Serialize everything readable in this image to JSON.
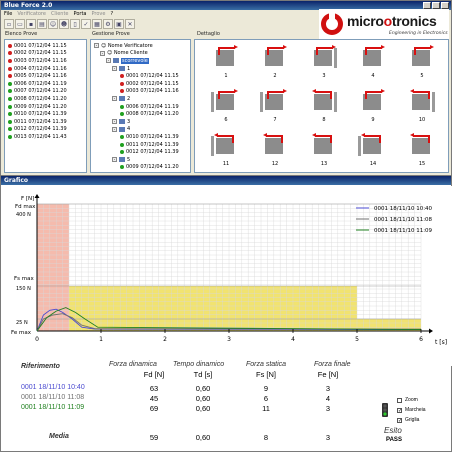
{
  "app": {
    "title": "Blue Force 2.0",
    "menu": [
      "File",
      "Verificatore",
      "Cliente",
      "Porta",
      "Prove",
      "?"
    ],
    "logo_text_black": "micro",
    "logo_text_red": "o",
    "logo_text_rest": "tronics",
    "logo_tagline": "Engineering in Electronics"
  },
  "elenco": {
    "header": "Elenco Prove",
    "items": [
      {
        "label": "0001 07/12/04 11.15",
        "status": "red"
      },
      {
        "label": "0002 07/12/04 11.15",
        "status": "red"
      },
      {
        "label": "0003 07/12/04 11.16",
        "status": "red"
      },
      {
        "label": "0004 07/12/04 11.16",
        "status": "red"
      },
      {
        "label": "0005 07/12/04 11.16",
        "status": "red"
      },
      {
        "label": "0006 07/12/04 11.19",
        "status": "green"
      },
      {
        "label": "0007 07/12/04 11.20",
        "status": "green"
      },
      {
        "label": "0008 07/12/04 11.20",
        "status": "green"
      },
      {
        "label": "0009 07/12/04 11.20",
        "status": "green"
      },
      {
        "label": "0010 07/12/04 11.39",
        "status": "green"
      },
      {
        "label": "0011 07/12/04 11.39",
        "status": "green"
      },
      {
        "label": "0012 07/12/04 11.39",
        "status": "green"
      },
      {
        "label": "0013 07/12/04 11.43",
        "status": "green"
      }
    ]
  },
  "gestione": {
    "header": "Gestione Prove",
    "root": "Nome Verificatore",
    "client": "Nome Cliente",
    "selected": "scorrevole",
    "groups": [
      {
        "num": "1",
        "items": [
          {
            "label": "0001 07/12/04 11.15",
            "status": "red"
          },
          {
            "label": "0002 07/12/04 11.15",
            "status": "red"
          },
          {
            "label": "0003 07/12/04 11.16",
            "status": "red"
          }
        ]
      },
      {
        "num": "2",
        "items": [
          {
            "label": "0006 07/12/04 11.19",
            "status": "green"
          },
          {
            "label": "0008 07/12/04 11.20",
            "status": "green"
          }
        ]
      },
      {
        "num": "3",
        "items": []
      },
      {
        "num": "4",
        "items": [
          {
            "label": "0010 07/12/04 11.39",
            "status": "green"
          },
          {
            "label": "0011 07/12/04 11.39",
            "status": "green"
          },
          {
            "label": "0012 07/12/04 11.39",
            "status": "green"
          }
        ]
      },
      {
        "num": "5",
        "items": [
          {
            "label": "0009 07/12/04 11.20",
            "status": "green"
          }
        ]
      }
    ]
  },
  "dettaglio": {
    "header": "Dettaglio",
    "cells": [
      "1",
      "2",
      "3",
      "4",
      "5",
      "6",
      "7",
      "8",
      "9",
      "10",
      "11",
      "12",
      "13",
      "14",
      "15"
    ]
  },
  "grafico": {
    "title": "Grafico",
    "y_unit": "F [N]",
    "x_unit": "t [s]",
    "fd_max_label": "Fd max",
    "fd_max_value": "400 N",
    "fs_max_label": "Fs max",
    "fs_max_value": "150 N",
    "fe_max_label": "Fe max",
    "fe_max_value": "25 N",
    "legend": [
      {
        "label": "0001 18/11/10 10:40",
        "color": "#4a4ad0"
      },
      {
        "label": "0001 18/11/10 11:08",
        "color": "#707070"
      },
      {
        "label": "0001 18/11/10 11:09",
        "color": "#208020"
      }
    ]
  },
  "chart_data": {
    "type": "line",
    "xlabel": "t (s)",
    "ylabel": "F [N]",
    "xlim": [
      0,
      6
    ],
    "x_ticks": [
      "0",
      "1",
      "2",
      "3",
      "4",
      "5",
      "6"
    ],
    "limits": {
      "Fd max": 400,
      "Fs max": 150,
      "Fe max": 25
    },
    "regions": [
      {
        "name": "dynamic",
        "x": [
          0,
          0.5
        ],
        "y": [
          0,
          400
        ],
        "color": "#f4b4a4"
      },
      {
        "name": "static",
        "x": [
          0.5,
          5
        ],
        "y": [
          0,
          150
        ],
        "color": "#f0e060"
      },
      {
        "name": "final",
        "x": [
          5,
          6
        ],
        "y": [
          0,
          25
        ],
        "color": "#f0e060"
      }
    ],
    "series": [
      {
        "name": "0001 18/11/10 10:40",
        "color": "#4a4ad0",
        "points": [
          [
            0,
            0
          ],
          [
            0.1,
            40
          ],
          [
            0.2,
            58
          ],
          [
            0.3,
            62
          ],
          [
            0.4,
            50
          ],
          [
            0.55,
            25
          ],
          [
            0.7,
            8
          ],
          [
            0.9,
            4
          ],
          [
            6,
            3
          ]
        ]
      },
      {
        "name": "0001 18/11/10 11:08",
        "color": "#707070",
        "points": [
          [
            0,
            0
          ],
          [
            0.1,
            25
          ],
          [
            0.25,
            40
          ],
          [
            0.4,
            45
          ],
          [
            0.55,
            30
          ],
          [
            0.7,
            12
          ],
          [
            0.9,
            5
          ],
          [
            6,
            4
          ]
        ]
      },
      {
        "name": "0001 18/11/10 11:09",
        "color": "#208020",
        "points": [
          [
            0,
            0
          ],
          [
            0.15,
            30
          ],
          [
            0.3,
            55
          ],
          [
            0.45,
            68
          ],
          [
            0.6,
            50
          ],
          [
            0.75,
            25
          ],
          [
            0.95,
            8
          ],
          [
            6,
            3
          ]
        ]
      }
    ]
  },
  "results": {
    "headers": {
      "riferimento": "Riferimento",
      "fd": "Forza dinamica",
      "td": "Tempo dinamico",
      "fs": "Forza statica",
      "fe": "Forza finale"
    },
    "units": {
      "fd": "Fd [N]",
      "td": "Td [s]",
      "fs": "Fs [N]",
      "fe": "Fe [N]"
    },
    "rows": [
      {
        "ref": "0001 18/11/10 10:40",
        "color": "#4a4ad0",
        "fd": "63",
        "td": "0,60",
        "fs": "9",
        "fe": "3"
      },
      {
        "ref": "0001 18/11/10 11:08",
        "color": "#707070",
        "fd": "45",
        "td": "0,60",
        "fs": "6",
        "fe": "4"
      },
      {
        "ref": "0001 18/11/10 11:09",
        "color": "#208020",
        "fd": "69",
        "td": "0,60",
        "fs": "11",
        "fe": "3"
      }
    ],
    "media_label": "Media",
    "media": {
      "fd": "59",
      "td": "0,60",
      "fs": "8",
      "fe": "3"
    },
    "options": [
      {
        "label": "Zoom",
        "checked": false
      },
      {
        "label": "Marcheia",
        "checked": true
      },
      {
        "label": "Griglia",
        "checked": true
      }
    ],
    "esito_label": "Esito",
    "esito_value": "PASS"
  }
}
